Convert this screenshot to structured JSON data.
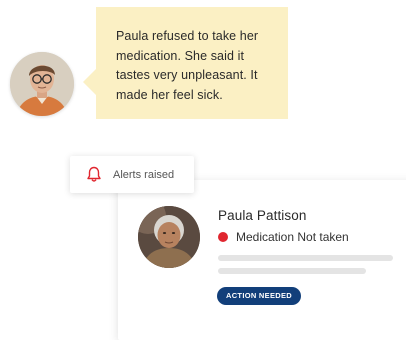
{
  "carer_note": {
    "text": "Paula refused to take her medication. She said it tastes very unpleasant. It made her feel sick."
  },
  "alerts_pill": {
    "label": "Alerts raised",
    "icon": "bell-icon"
  },
  "patient_card": {
    "name": "Paula Pattison",
    "status_text": "Medication Not taken",
    "badge_label": "ACTION NEEDED"
  },
  "colors": {
    "note_bg": "#fbf0c4",
    "alert_red": "#e0262f",
    "badge_navy": "#123f7a",
    "placeholder": "#e4e4e4"
  }
}
